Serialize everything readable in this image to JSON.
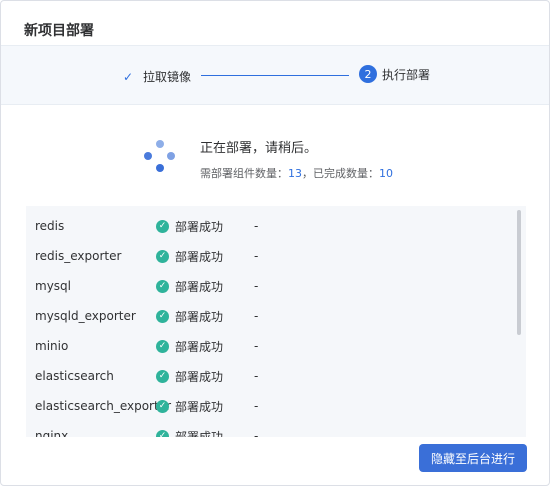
{
  "dialog": {
    "title": "新项目部署"
  },
  "steps": [
    {
      "label": "拉取镜像",
      "state": "done"
    },
    {
      "number": "2",
      "label": "执行部署",
      "state": "active"
    }
  ],
  "status": {
    "message": "正在部署，请稍后。",
    "total_label": "需部署组件数量：",
    "total": "13",
    "separator": "，",
    "completed_label": "已完成数量：",
    "completed": "10"
  },
  "components": [
    {
      "name": "redis",
      "status": "部署成功",
      "extra": "-"
    },
    {
      "name": "redis_exporter",
      "status": "部署成功",
      "extra": "-"
    },
    {
      "name": "mysql",
      "status": "部署成功",
      "extra": "-"
    },
    {
      "name": "mysqld_exporter",
      "status": "部署成功",
      "extra": "-"
    },
    {
      "name": "minio",
      "status": "部署成功",
      "extra": "-"
    },
    {
      "name": "elasticsearch",
      "status": "部署成功",
      "extra": "-"
    },
    {
      "name": "elasticsearch_exporter",
      "status": "部署成功",
      "extra": "-"
    },
    {
      "name": "nginx",
      "status": "部署成功",
      "extra": "-"
    }
  ],
  "footer": {
    "hide_button_label": "隐藏至后台进行"
  },
  "colors": {
    "primary": "#3a6fd8",
    "success": "#2fb39b"
  }
}
